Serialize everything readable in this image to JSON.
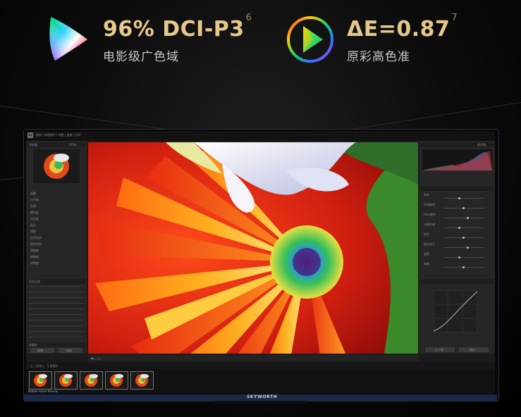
{
  "spec_left": {
    "title": "96% DCI-P3",
    "sup": "6",
    "subtitle": "电影级广色域",
    "icon": "color-gamut-triangle-icon"
  },
  "spec_right": {
    "title": "ΔE=0.87",
    "sup": "7",
    "subtitle": "原彩高色准",
    "icon": "color-accuracy-play-icon"
  },
  "tv": {
    "brand": "SKYWORTH"
  },
  "lightroom": {
    "left_panel_title": "导航器",
    "right_panel_title": "直方图",
    "history_title": "历史记录",
    "collections_title": "收藏夹",
    "copy_button": "复制...",
    "paste_button": "粘贴",
    "prev_button": "上一张",
    "reset_button": "复位",
    "zoom_level": "100%",
    "left_menu": [
      "调整",
      "白平衡",
      "色调",
      "曝光度",
      "对比度",
      "高光",
      "阴影",
      "白色色阶",
      "黑色色阶",
      "清晰度",
      "鲜艳度",
      "饱和度"
    ],
    "right_menu": [
      "基本",
      "色调曲线",
      "HSL/颜色",
      "分离色调",
      "细节",
      "镜头校正",
      "变换",
      "效果"
    ],
    "filmstrip_label": "上一次导入 · 5 张照片",
    "footer_left": "Mobile Vision Review"
  },
  "colors": {
    "gold": "#e6c98a",
    "subtext": "#c7c7c7",
    "tv_bar": "#1d2747"
  }
}
